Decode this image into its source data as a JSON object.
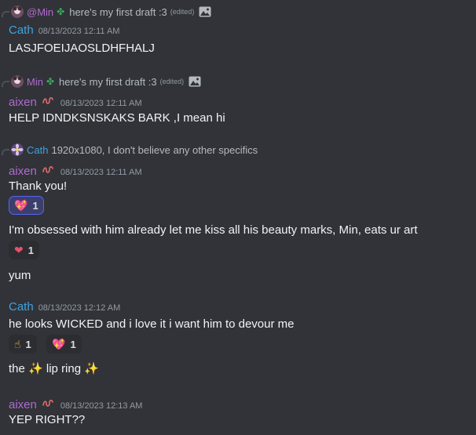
{
  "replies": [
    {
      "name": "@Min",
      "text": "here's my first draft :3",
      "edited": "(edited)",
      "name_color": "#b06ad0",
      "has_image": true
    },
    {
      "name": "Min",
      "text": "here's my first draft :3",
      "edited": "(edited)",
      "name_color": "#b06ad0",
      "has_image": true
    },
    {
      "name": "Cath",
      "text": "1920x1080, I don't believe any other specifics",
      "name_color": "#3fa2e0"
    }
  ],
  "messages": [
    {
      "author": "Cath",
      "timestamp": "08/13/2023 12:11 AM",
      "text": "LASJFOEIJAOSLDHFHALJ"
    },
    {
      "author": "aixen",
      "timestamp": "08/13/2023 12:11 AM",
      "text": "HELP IDNDKSNSKAKS BARK ,I mean hi"
    },
    {
      "author": "aixen",
      "timestamp": "08/13/2023 12:11 AM",
      "text": "Thank you!"
    },
    {
      "text": "I'm obsessed with him already  let me kiss all his beauty marks, Min, eats ur art"
    },
    {
      "text": "yum"
    },
    {
      "author": "Cath",
      "timestamp": "08/13/2023 12:12 AM",
      "text": "he looks WICKED and i love it i want him to devour me"
    },
    {
      "text_before": "the",
      "text_after": "lip ring"
    },
    {
      "author": "aixen",
      "timestamp": "08/13/2023 12:13 AM",
      "text": "YEP RIGHT??"
    }
  ],
  "reactions": [
    {
      "emoji": "💖",
      "count": "1"
    },
    {
      "emoji": "❤",
      "count": "1"
    },
    {
      "emoji": "☝",
      "count": "1"
    },
    {
      "emoji": "💖",
      "count": "1"
    }
  ],
  "colors": {
    "background": "#313338",
    "cath": "#3fa2e0",
    "aixen": "#b06ad0",
    "clover": "#3ba55d",
    "active_reaction": "#5865f2"
  }
}
